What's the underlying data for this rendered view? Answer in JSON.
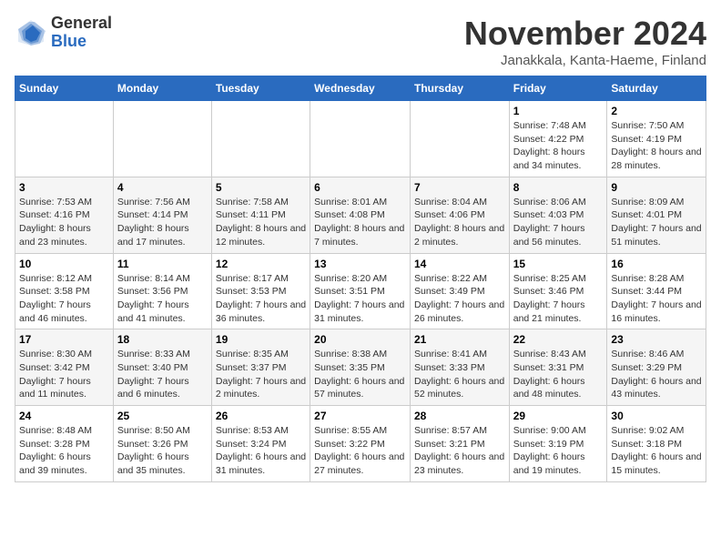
{
  "logo": {
    "general": "General",
    "blue": "Blue"
  },
  "title": "November 2024",
  "location": "Janakkala, Kanta-Haeme, Finland",
  "weekdays": [
    "Sunday",
    "Monday",
    "Tuesday",
    "Wednesday",
    "Thursday",
    "Friday",
    "Saturday"
  ],
  "weeks": [
    [
      null,
      null,
      null,
      null,
      null,
      {
        "day": "1",
        "sunrise": "Sunrise: 7:48 AM",
        "sunset": "Sunset: 4:22 PM",
        "daylight": "Daylight: 8 hours and 34 minutes."
      },
      {
        "day": "2",
        "sunrise": "Sunrise: 7:50 AM",
        "sunset": "Sunset: 4:19 PM",
        "daylight": "Daylight: 8 hours and 28 minutes."
      }
    ],
    [
      {
        "day": "3",
        "sunrise": "Sunrise: 7:53 AM",
        "sunset": "Sunset: 4:16 PM",
        "daylight": "Daylight: 8 hours and 23 minutes."
      },
      {
        "day": "4",
        "sunrise": "Sunrise: 7:56 AM",
        "sunset": "Sunset: 4:14 PM",
        "daylight": "Daylight: 8 hours and 17 minutes."
      },
      {
        "day": "5",
        "sunrise": "Sunrise: 7:58 AM",
        "sunset": "Sunset: 4:11 PM",
        "daylight": "Daylight: 8 hours and 12 minutes."
      },
      {
        "day": "6",
        "sunrise": "Sunrise: 8:01 AM",
        "sunset": "Sunset: 4:08 PM",
        "daylight": "Daylight: 8 hours and 7 minutes."
      },
      {
        "day": "7",
        "sunrise": "Sunrise: 8:04 AM",
        "sunset": "Sunset: 4:06 PM",
        "daylight": "Daylight: 8 hours and 2 minutes."
      },
      {
        "day": "8",
        "sunrise": "Sunrise: 8:06 AM",
        "sunset": "Sunset: 4:03 PM",
        "daylight": "Daylight: 7 hours and 56 minutes."
      },
      {
        "day": "9",
        "sunrise": "Sunrise: 8:09 AM",
        "sunset": "Sunset: 4:01 PM",
        "daylight": "Daylight: 7 hours and 51 minutes."
      }
    ],
    [
      {
        "day": "10",
        "sunrise": "Sunrise: 8:12 AM",
        "sunset": "Sunset: 3:58 PM",
        "daylight": "Daylight: 7 hours and 46 minutes."
      },
      {
        "day": "11",
        "sunrise": "Sunrise: 8:14 AM",
        "sunset": "Sunset: 3:56 PM",
        "daylight": "Daylight: 7 hours and 41 minutes."
      },
      {
        "day": "12",
        "sunrise": "Sunrise: 8:17 AM",
        "sunset": "Sunset: 3:53 PM",
        "daylight": "Daylight: 7 hours and 36 minutes."
      },
      {
        "day": "13",
        "sunrise": "Sunrise: 8:20 AM",
        "sunset": "Sunset: 3:51 PM",
        "daylight": "Daylight: 7 hours and 31 minutes."
      },
      {
        "day": "14",
        "sunrise": "Sunrise: 8:22 AM",
        "sunset": "Sunset: 3:49 PM",
        "daylight": "Daylight: 7 hours and 26 minutes."
      },
      {
        "day": "15",
        "sunrise": "Sunrise: 8:25 AM",
        "sunset": "Sunset: 3:46 PM",
        "daylight": "Daylight: 7 hours and 21 minutes."
      },
      {
        "day": "16",
        "sunrise": "Sunrise: 8:28 AM",
        "sunset": "Sunset: 3:44 PM",
        "daylight": "Daylight: 7 hours and 16 minutes."
      }
    ],
    [
      {
        "day": "17",
        "sunrise": "Sunrise: 8:30 AM",
        "sunset": "Sunset: 3:42 PM",
        "daylight": "Daylight: 7 hours and 11 minutes."
      },
      {
        "day": "18",
        "sunrise": "Sunrise: 8:33 AM",
        "sunset": "Sunset: 3:40 PM",
        "daylight": "Daylight: 7 hours and 6 minutes."
      },
      {
        "day": "19",
        "sunrise": "Sunrise: 8:35 AM",
        "sunset": "Sunset: 3:37 PM",
        "daylight": "Daylight: 7 hours and 2 minutes."
      },
      {
        "day": "20",
        "sunrise": "Sunrise: 8:38 AM",
        "sunset": "Sunset: 3:35 PM",
        "daylight": "Daylight: 6 hours and 57 minutes."
      },
      {
        "day": "21",
        "sunrise": "Sunrise: 8:41 AM",
        "sunset": "Sunset: 3:33 PM",
        "daylight": "Daylight: 6 hours and 52 minutes."
      },
      {
        "day": "22",
        "sunrise": "Sunrise: 8:43 AM",
        "sunset": "Sunset: 3:31 PM",
        "daylight": "Daylight: 6 hours and 48 minutes."
      },
      {
        "day": "23",
        "sunrise": "Sunrise: 8:46 AM",
        "sunset": "Sunset: 3:29 PM",
        "daylight": "Daylight: 6 hours and 43 minutes."
      }
    ],
    [
      {
        "day": "24",
        "sunrise": "Sunrise: 8:48 AM",
        "sunset": "Sunset: 3:28 PM",
        "daylight": "Daylight: 6 hours and 39 minutes."
      },
      {
        "day": "25",
        "sunrise": "Sunrise: 8:50 AM",
        "sunset": "Sunset: 3:26 PM",
        "daylight": "Daylight: 6 hours and 35 minutes."
      },
      {
        "day": "26",
        "sunrise": "Sunrise: 8:53 AM",
        "sunset": "Sunset: 3:24 PM",
        "daylight": "Daylight: 6 hours and 31 minutes."
      },
      {
        "day": "27",
        "sunrise": "Sunrise: 8:55 AM",
        "sunset": "Sunset: 3:22 PM",
        "daylight": "Daylight: 6 hours and 27 minutes."
      },
      {
        "day": "28",
        "sunrise": "Sunrise: 8:57 AM",
        "sunset": "Sunset: 3:21 PM",
        "daylight": "Daylight: 6 hours and 23 minutes."
      },
      {
        "day": "29",
        "sunrise": "Sunrise: 9:00 AM",
        "sunset": "Sunset: 3:19 PM",
        "daylight": "Daylight: 6 hours and 19 minutes."
      },
      {
        "day": "30",
        "sunrise": "Sunrise: 9:02 AM",
        "sunset": "Sunset: 3:18 PM",
        "daylight": "Daylight: 6 hours and 15 minutes."
      }
    ]
  ]
}
